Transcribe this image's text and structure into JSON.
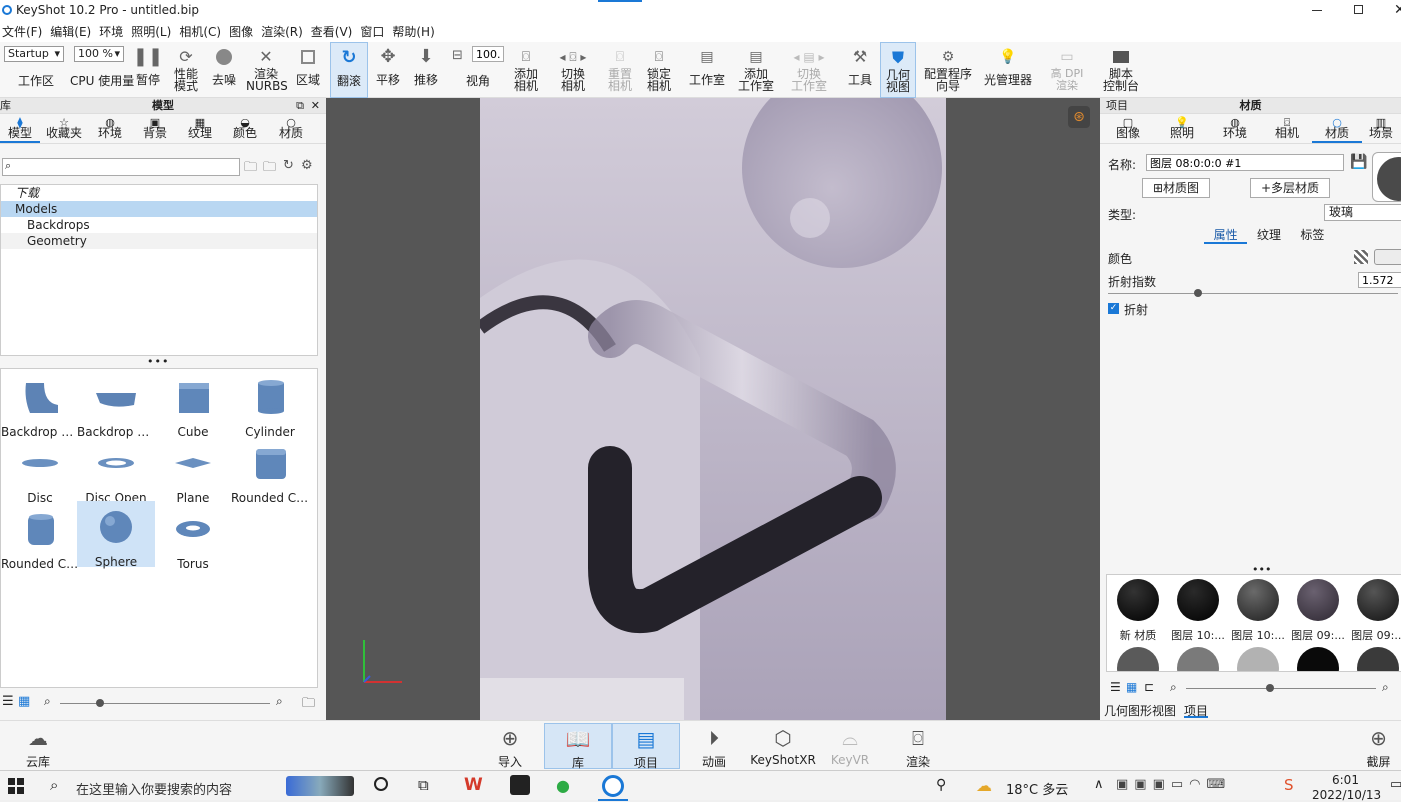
{
  "app": {
    "title": "KeyShot 10.2 Pro  - untitled.bip"
  },
  "menu": [
    "文件(F)",
    "编辑(E)",
    "环境",
    "照明(L)",
    "相机(C)",
    "图像",
    "渲染(R)",
    "查看(V)",
    "窗口",
    "帮助(H)"
  ],
  "toolbar": {
    "workspace_value": "Startup",
    "workspace_label": "工作区",
    "zoom_value": "100 %",
    "cpu_label": "CPU 使用量",
    "pause": "暂停",
    "perf": "性能\n模式",
    "denoise": "去噪",
    "nurbs": "渲染\nNURBS",
    "region": "区域",
    "tumble": "翻滚",
    "pan": "平移",
    "dolly": "推移",
    "fov_value": "100.0",
    "fov_label": "视角",
    "add_cam": "添加\n相机",
    "switch_cam": "切换\n相机",
    "reset_cam": "重置\n相机",
    "lock_cam": "锁定\n相机",
    "studio": "工作室",
    "add_studio": "添加\n工作室",
    "switch_studio": "切换\n工作室",
    "tools": "工具",
    "geo_view": "几何\n视图",
    "config": "配置程序\n向导",
    "light_mgr": "光管理器",
    "hidpi": "高 DPI\n渲染",
    "script": "脚本\n控制台"
  },
  "library": {
    "title": "模型",
    "side_label": "库",
    "tabs": [
      "模型",
      "收藏夹",
      "环境",
      "背景",
      "纹理",
      "颜色",
      "材质"
    ],
    "search_placeholder": "",
    "tree": [
      "下载",
      "Models",
      "Backdrops",
      "Geometry"
    ],
    "models": [
      "Backdrop R...",
      "Backdrop R...",
      "Cube",
      "Cylinder",
      "Disc",
      "Disc Open",
      "Plane",
      "Rounded Cu...",
      "Rounded Cy...",
      "Sphere",
      "Torus"
    ]
  },
  "project": {
    "title": "材质",
    "side_label": "项目",
    "tabs": [
      "图像",
      "照明",
      "环境",
      "相机",
      "材质",
      "场景"
    ],
    "name_label": "名称:",
    "name_value": "图层 08:0:0:0 #1",
    "material_graph": "材质图",
    "multi_material": "多层材质",
    "type_label": "类型:",
    "type_value": "玻璃",
    "subtabs": [
      "属性",
      "纹理",
      "标签"
    ],
    "color_label": "颜色",
    "refr_label": "折射指数",
    "refr_value": "1.572",
    "refraction_cb": "折射",
    "materials": [
      "新 材质",
      "图层 10:...",
      "图层 10:...",
      "图层 09:...",
      "图层 09:..."
    ],
    "bottom_tabs": [
      "几何图形视图",
      "项目"
    ]
  },
  "bottom": {
    "cloud": "云库",
    "import": "导入",
    "library": "库",
    "project": "项目",
    "animation": "动画",
    "keyshotxr": "KeyShotXR",
    "keyvr": "KeyVR",
    "render": "渲染",
    "screenshot": "截屏"
  },
  "taskbar": {
    "search": "在这里输入你要搜索的内容",
    "weather": "18°C 多云",
    "time": "6:01",
    "date": "2022/10/13"
  },
  "colors": {
    "accent": "#1a78d6",
    "viewport_bg": "#565656",
    "scene_bg": "#b9b2c6"
  }
}
